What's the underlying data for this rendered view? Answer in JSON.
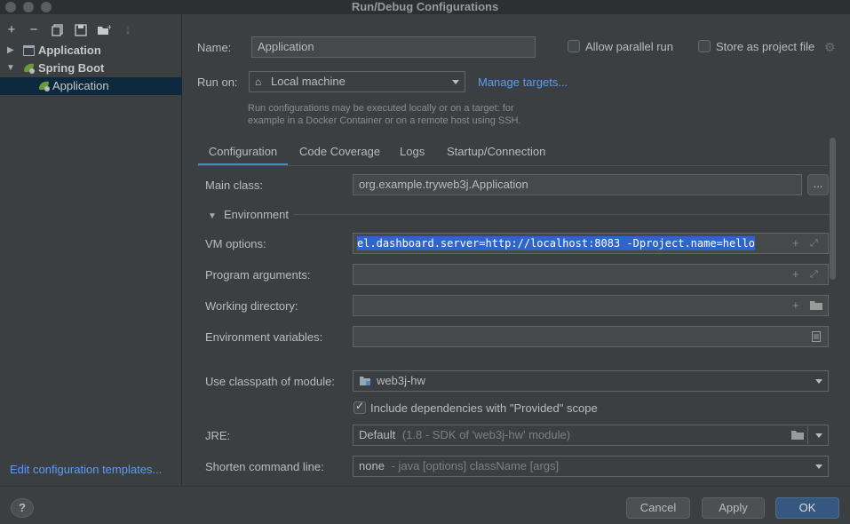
{
  "window": {
    "title": "Run/Debug Configurations"
  },
  "toolbar": {
    "add": "+",
    "remove": "−",
    "sort": "↓"
  },
  "tree": {
    "items": [
      {
        "label": "Application",
        "bold": true
      },
      {
        "label": "Spring Boot",
        "bold": true
      },
      {
        "label": "Application",
        "bold": false
      }
    ]
  },
  "left_footer": {
    "edit_templates": "Edit configuration templates..."
  },
  "form": {
    "name_label": "Name:",
    "name_value": "Application",
    "allow_parallel": "Allow parallel run",
    "store_as_file": "Store as project file",
    "run_on_label": "Run on:",
    "run_on_value": "Local machine",
    "manage_targets": "Manage targets...",
    "hint_line1": "Run configurations may be executed locally or on a target: for",
    "hint_line2": "example in a Docker Container or on a remote host using SSH."
  },
  "tabs": [
    {
      "label": "Configuration"
    },
    {
      "label": "Code Coverage"
    },
    {
      "label": "Logs"
    },
    {
      "label": "Startup/Connection"
    }
  ],
  "config": {
    "main_class_label": "Main class:",
    "main_class_value": "org.example.tryweb3j.Application",
    "more_button": "...",
    "environment_label": "Environment",
    "vm_options_label": "VM options:",
    "vm_options_value": "el.dashboard.server=http://localhost:8083 -Dproject.name=hello",
    "program_args_label": "Program arguments:",
    "working_dir_label": "Working directory:",
    "env_vars_label": "Environment variables:",
    "classpath_label": "Use classpath of module:",
    "classpath_value": "web3j-hw",
    "include_deps": "Include dependencies with \"Provided\" scope",
    "jre_label": "JRE:",
    "jre_value": "Default",
    "jre_detail": "(1.8 - SDK of 'web3j-hw' module)",
    "shorten_label": "Shorten command line:",
    "shorten_value": "none",
    "shorten_detail": "- java [options] className [args]"
  },
  "buttons": {
    "help": "?",
    "cancel": "Cancel",
    "apply": "Apply",
    "ok": "OK"
  }
}
